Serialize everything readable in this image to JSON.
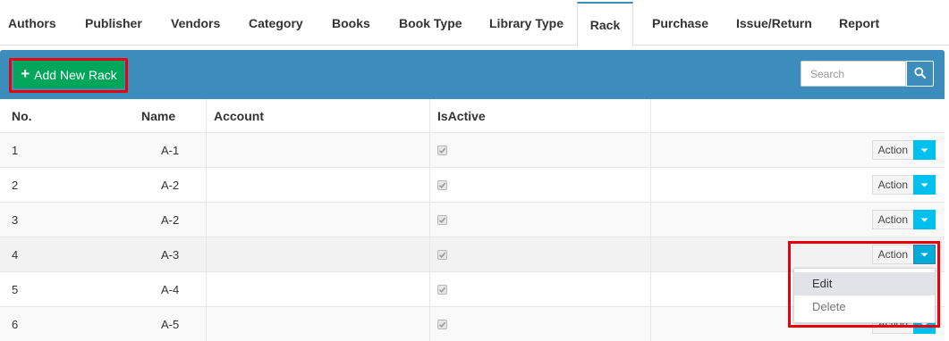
{
  "tabs": [
    {
      "label": "Authors",
      "active": false
    },
    {
      "label": "Publisher",
      "active": false
    },
    {
      "label": "Vendors",
      "active": false
    },
    {
      "label": "Category",
      "active": false
    },
    {
      "label": "Books",
      "active": false
    },
    {
      "label": "Book Type",
      "active": false
    },
    {
      "label": "Library Type",
      "active": false
    },
    {
      "label": "Rack",
      "active": true
    },
    {
      "label": "Purchase",
      "active": false
    },
    {
      "label": "Issue/Return",
      "active": false
    },
    {
      "label": "Report",
      "active": false
    }
  ],
  "panel": {
    "add_label": "Add New Rack",
    "search_placeholder": "Search",
    "header_color": "#3c8dbc",
    "add_color": "#00a65a"
  },
  "table": {
    "columns": {
      "no": "No.",
      "name": "Name",
      "account": "Account",
      "is_active": "IsActive",
      "actions": ""
    },
    "rows": [
      {
        "no": "1",
        "name": "A-1",
        "account": "",
        "is_active": true
      },
      {
        "no": "2",
        "name": "A-2",
        "account": "",
        "is_active": true
      },
      {
        "no": "3",
        "name": "A-2",
        "account": "",
        "is_active": true
      },
      {
        "no": "4",
        "name": "A-3",
        "account": "",
        "is_active": true
      },
      {
        "no": "5",
        "name": "A-4",
        "account": "",
        "is_active": true
      },
      {
        "no": "6",
        "name": "A-5",
        "account": "",
        "is_active": true
      }
    ],
    "action_label": "Action"
  },
  "dropdown": {
    "open_for_row": "4",
    "items": [
      "Edit",
      "Delete"
    ]
  },
  "highlight_color": "#e8000b",
  "icons": {
    "add": "plus-icon",
    "search": "search-icon",
    "caret": "caret-down-icon",
    "check": "check-icon"
  }
}
